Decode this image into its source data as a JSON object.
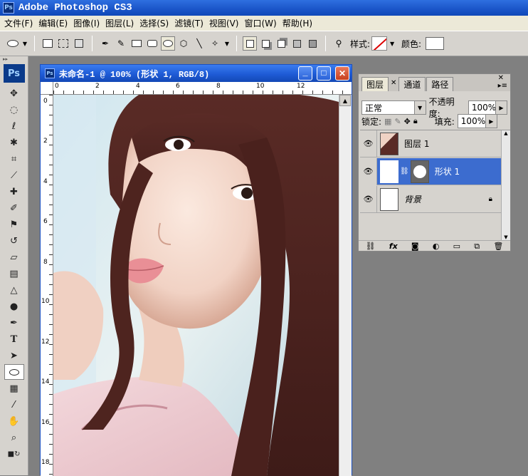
{
  "app": {
    "title": "Adobe Photoshop CS3",
    "logo": "Ps"
  },
  "menu": [
    "文件(F)",
    "编辑(E)",
    "图像(I)",
    "图层(L)",
    "选择(S)",
    "滤镜(T)",
    "视图(V)",
    "窗口(W)",
    "帮助(H)"
  ],
  "options": {
    "style_label": "样式:",
    "color_label": "颜色:"
  },
  "document": {
    "title": "未命名-1 @ 100% (形状 1, RGB/8)",
    "ruler_top": [
      "0",
      "2",
      "4",
      "6",
      "8",
      "10",
      "12"
    ],
    "ruler_left": [
      "0",
      "2",
      "4",
      "6",
      "8",
      "10",
      "12",
      "14",
      "16",
      "18"
    ]
  },
  "layers_panel": {
    "tabs": [
      "图层",
      "通道",
      "路径"
    ],
    "blend_mode": "正常",
    "opacity_label": "不透明度:",
    "opacity_value": "100%",
    "lock_label": "锁定:",
    "fill_label": "填充:",
    "fill_value": "100%",
    "layers": [
      {
        "name": "图层 1",
        "selected": false
      },
      {
        "name": "形状 1",
        "selected": true
      },
      {
        "name": "背景",
        "selected": false
      }
    ]
  },
  "colors": {
    "accent": "#3c6ccf",
    "titlebar": "#1a55c8"
  }
}
